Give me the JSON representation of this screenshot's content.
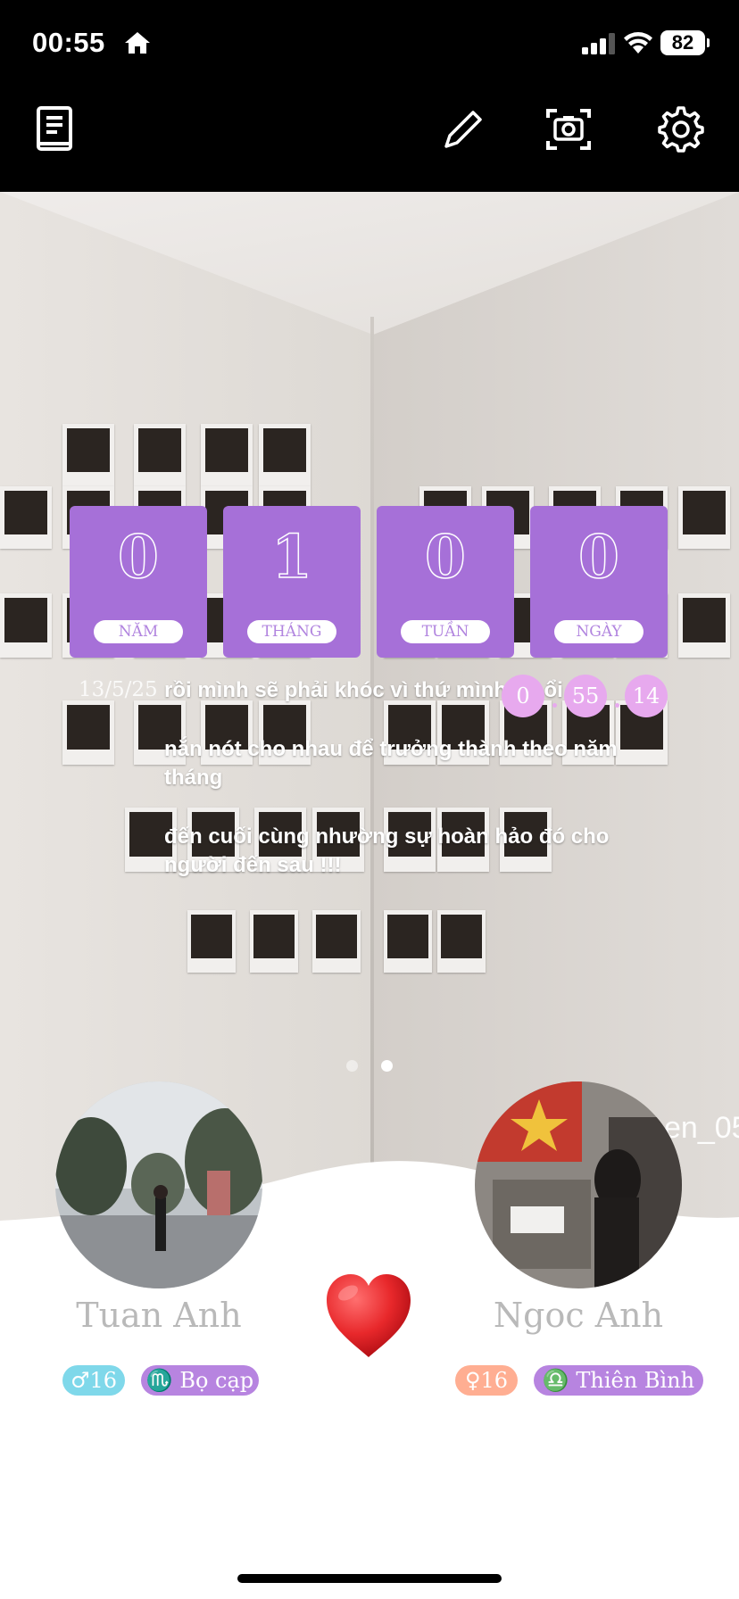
{
  "status_bar": {
    "time": "00:55",
    "battery": "82"
  },
  "toolbar": {
    "icons": [
      "book-icon",
      "pencil-icon",
      "camera-icon",
      "gear-icon"
    ]
  },
  "counters": [
    {
      "value": "0",
      "label": "NĂM"
    },
    {
      "value": "1",
      "label": "THÁNG"
    },
    {
      "value": "0",
      "label": "TUẦN"
    },
    {
      "value": "0",
      "label": "NGÀY"
    }
  ],
  "date": "13/5/25",
  "message": {
    "line1": "rồi mình sẽ phải khóc vì thứ mình",
    "line1_tail": "ỉm",
    "line1_end": "ổi",
    "line2": "nắn nót cho nhau để trưởng thành theo năm tháng",
    "line3": "đến cuối cùng nhường sự hoàn hảo đó cho người đến sau !!!"
  },
  "clock": {
    "hours": "0",
    "minutes": "55",
    "seconds": "14"
  },
  "watermark": "en_05",
  "person_left": {
    "name": "Tuan Anh",
    "gender_age": "♂16",
    "zodiac": "♏ Bọ cạp"
  },
  "person_right": {
    "name": "Ngoc Anh",
    "gender_age": "♀16",
    "zodiac": "♎ Thiên Bình"
  },
  "colors": {
    "accent_purple": "#a670d8",
    "clock_pink": "#e7a9ee",
    "male_tag": "#7fd8ea",
    "female_tag": "#ffae92",
    "zodiac_tag": "#b784e0",
    "heart": "#e8282b"
  }
}
